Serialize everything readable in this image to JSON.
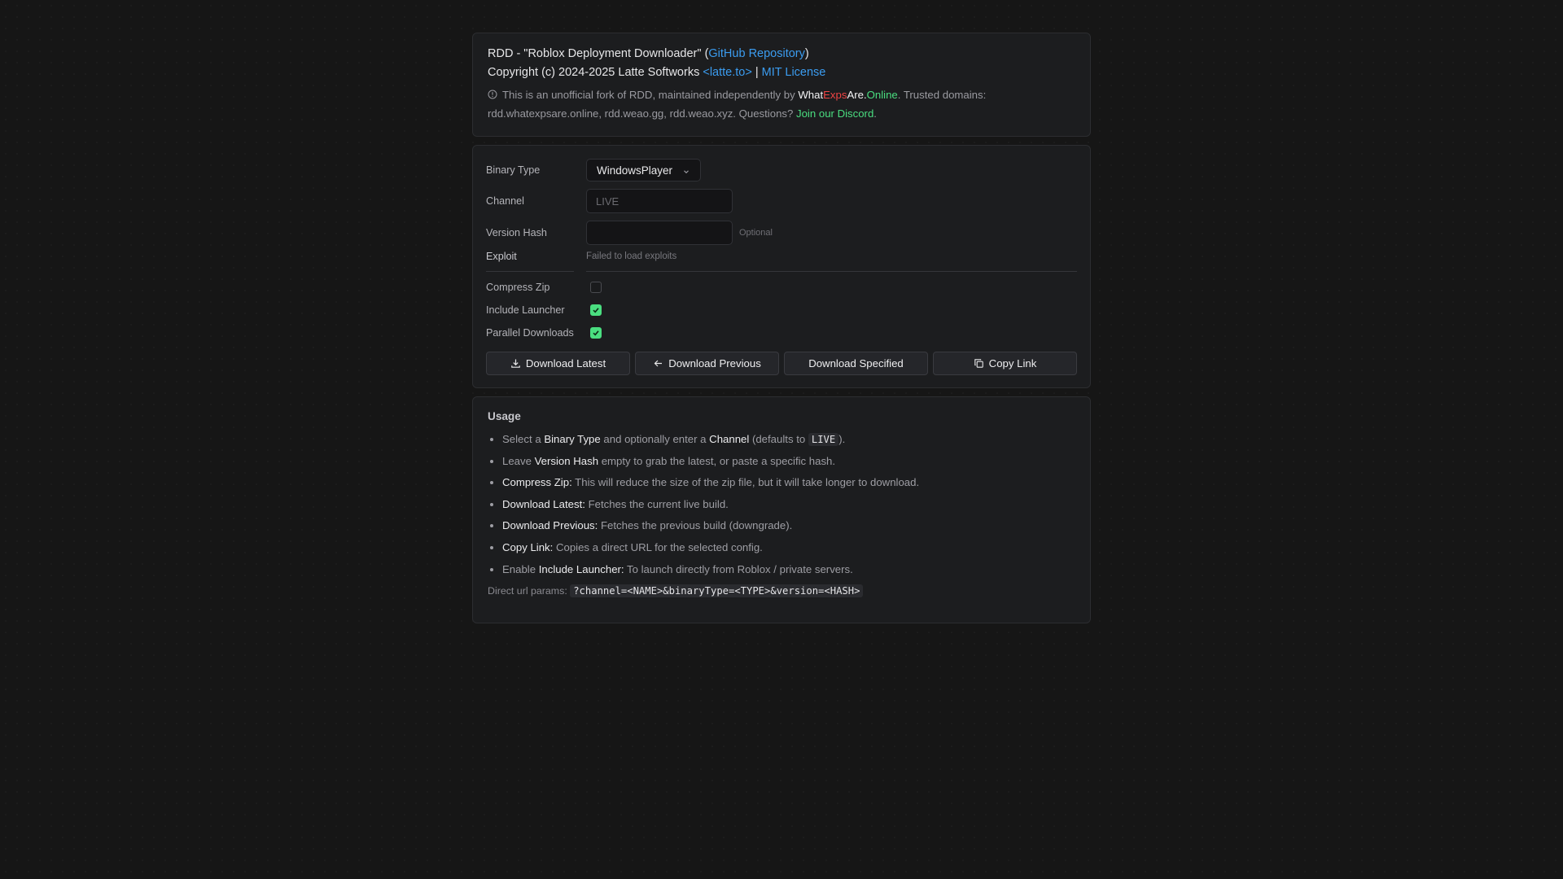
{
  "header": {
    "title_prefix": "RDD - \"Roblox Deployment Downloader\" (",
    "github_link": "GitHub Repository",
    "title_suffix": ")",
    "copyright_prefix": "Copyright (c) 2024-2025 Latte Softworks ",
    "latte_link": "<latte.to>",
    "separator": " | ",
    "license_link": "MIT License",
    "notice_prefix": "This is an unofficial fork of RDD, maintained independently by ",
    "brand_what": "What",
    "brand_exps": "Exps",
    "brand_are": "Are.",
    "brand_online": "Online",
    "notice_middle": ". Trusted domains: rdd.whatexpsare.online, rdd.weao.gg, rdd.weao.xyz. Questions? ",
    "discord_link": "Join our Discord",
    "notice_end": ".",
    "info_icon": "info-circle-icon"
  },
  "form": {
    "binary_type_label": "Binary Type",
    "binary_type_value": "WindowsPlayer",
    "channel_label": "Channel",
    "channel_placeholder": "LIVE",
    "channel_value": "",
    "version_hash_label": "Version Hash",
    "version_hash_value": "",
    "version_hash_hint": "Optional",
    "exploit_label": "Exploit",
    "exploit_status": "Failed to load exploits",
    "compress_zip_label": "Compress Zip",
    "compress_zip_checked": false,
    "include_launcher_label": "Include Launcher",
    "include_launcher_checked": true,
    "parallel_downloads_label": "Parallel Downloads",
    "parallel_downloads_checked": true,
    "accent_color": "#4ade80"
  },
  "buttons": {
    "download_latest": "Download Latest",
    "download_previous": "Download Previous",
    "download_specified": "Download Specified",
    "copy_link": "Copy Link"
  },
  "usage": {
    "title": "Usage",
    "items": [
      {
        "a": "Select a ",
        "b": "Binary Type",
        "c": " and optionally enter a ",
        "d": "Channel",
        "e": " (defaults to ",
        "code": "LIVE",
        "f": ")."
      },
      {
        "a": "Leave ",
        "b": "Version Hash",
        "c": " empty to grab the latest, or paste a specific hash."
      },
      {
        "b": "Compress Zip:",
        "c": " This will reduce the size of the zip file, but it will take longer to download."
      },
      {
        "b": "Download Latest:",
        "c": " Fetches the current live build."
      },
      {
        "b": "Download Previous:",
        "c": " Fetches the previous build (downgrade)."
      },
      {
        "b": "Copy Link:",
        "c": " Copies a direct URL for the selected config."
      },
      {
        "a": "Enable ",
        "b": "Include Launcher:",
        "c": " To launch directly from Roblox / private servers."
      }
    ],
    "params_label": "Direct url params: ",
    "params_code": "?channel=<NAME>&binaryType=<TYPE>&version=<HASH>"
  }
}
